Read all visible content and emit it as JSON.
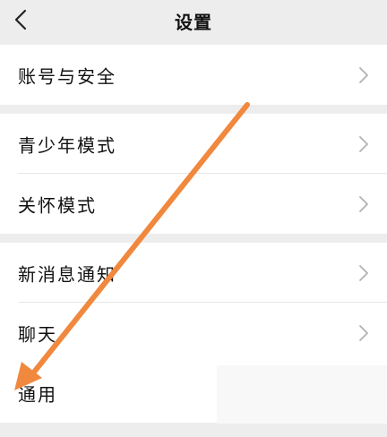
{
  "header": {
    "title": "设置",
    "back_icon": "chevron-left-icon"
  },
  "groups": [
    {
      "items": [
        {
          "label": "账号与安全"
        }
      ]
    },
    {
      "items": [
        {
          "label": "青少年模式"
        },
        {
          "label": "关怀模式"
        }
      ]
    },
    {
      "items": [
        {
          "label": "新消息通知"
        },
        {
          "label": "聊天"
        },
        {
          "label": "通用"
        }
      ]
    }
  ],
  "annotation": {
    "type": "arrow",
    "color": "#f0883e",
    "points_to": "通用"
  }
}
